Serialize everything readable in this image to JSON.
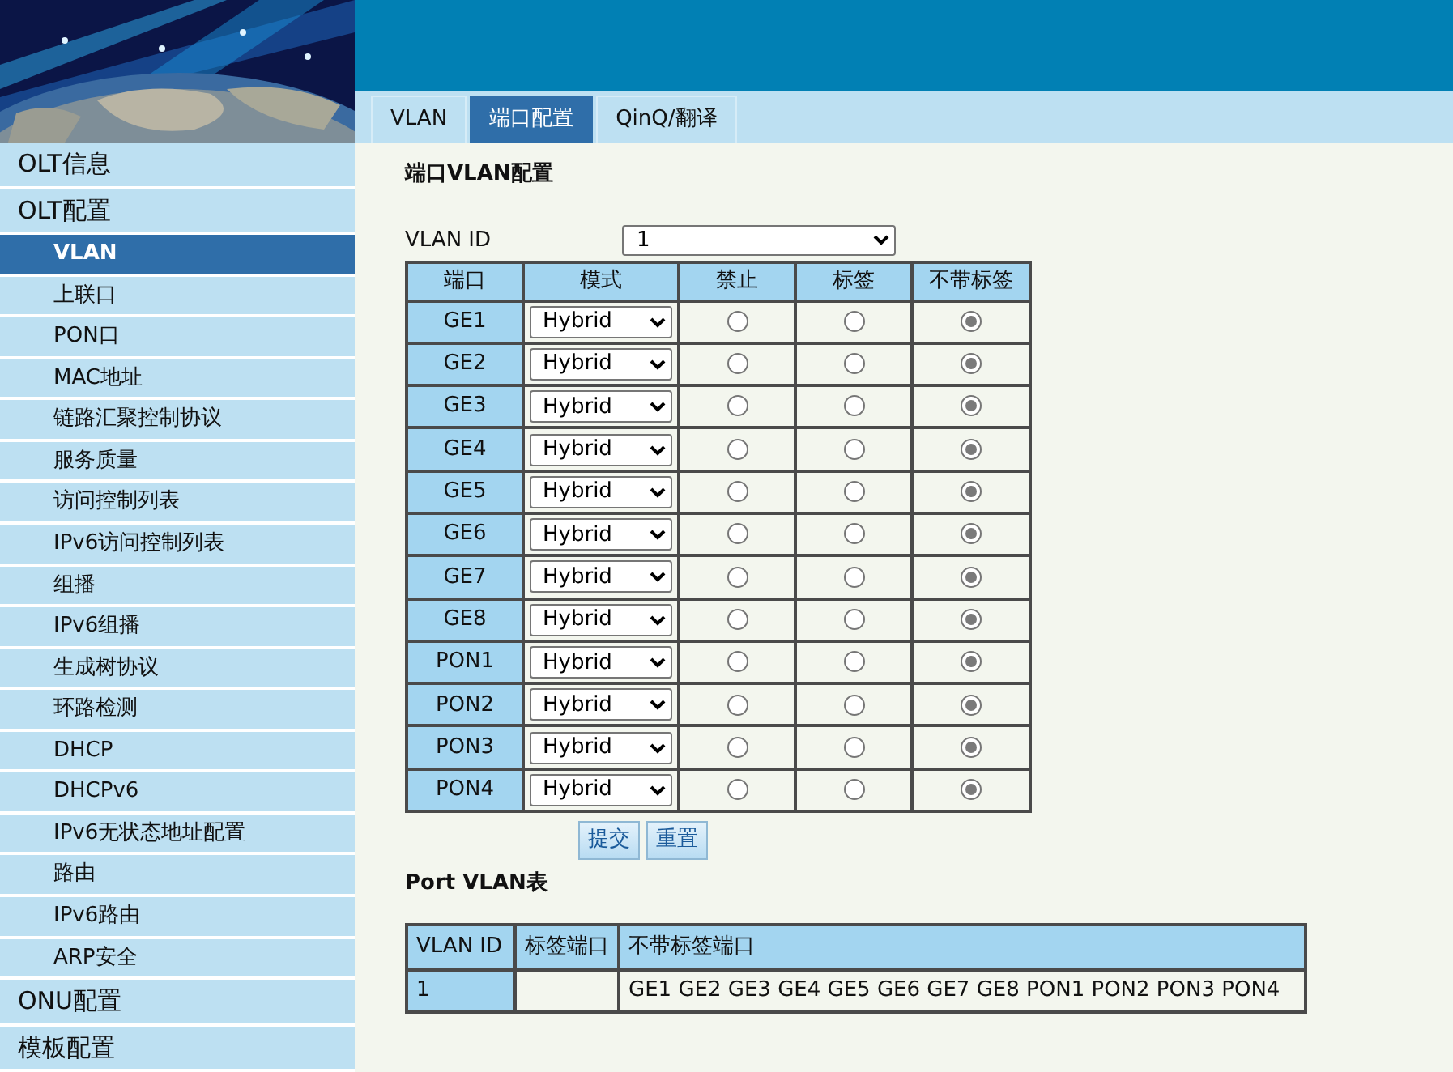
{
  "tabs": [
    {
      "label": "VLAN",
      "selected": false
    },
    {
      "label": "端口配置",
      "selected": true
    },
    {
      "label": "QinQ/翻译",
      "selected": false
    }
  ],
  "sidebar": {
    "items": [
      {
        "label": "OLT信息",
        "expanded": false
      },
      {
        "label": "OLT配置",
        "expanded": true,
        "children": [
          {
            "label": "VLAN",
            "selected": true
          },
          {
            "label": "上联口",
            "selected": false
          },
          {
            "label": "PON口",
            "selected": false
          },
          {
            "label": "MAC地址",
            "selected": false
          },
          {
            "label": "链路汇聚控制协议",
            "selected": false
          },
          {
            "label": "服务质量",
            "selected": false
          },
          {
            "label": "访问控制列表",
            "selected": false
          },
          {
            "label": "IPv6访问控制列表",
            "selected": false
          },
          {
            "label": "组播",
            "selected": false
          },
          {
            "label": "IPv6组播",
            "selected": false
          },
          {
            "label": "生成树协议",
            "selected": false
          },
          {
            "label": "环路检测",
            "selected": false
          },
          {
            "label": "DHCP",
            "selected": false
          },
          {
            "label": "DHCPv6",
            "selected": false
          },
          {
            "label": "IPv6无状态地址配置",
            "selected": false
          },
          {
            "label": "路由",
            "selected": false
          },
          {
            "label": "IPv6路由",
            "selected": false
          },
          {
            "label": "ARP安全",
            "selected": false
          }
        ]
      },
      {
        "label": "ONU配置",
        "expanded": false
      },
      {
        "label": "模板配置",
        "expanded": false
      }
    ]
  },
  "section_title": "端口VLAN配置",
  "vlan_id": {
    "label": "VLAN ID",
    "value": "1"
  },
  "port_table": {
    "columns": [
      "端口",
      "模式",
      "禁止",
      "标签",
      "不带标签"
    ],
    "rows": [
      {
        "port": "GE1",
        "mode": "Hybrid",
        "options": [
          {
            "selected": false
          },
          {
            "selected": false
          },
          {
            "selected": true
          }
        ]
      },
      {
        "port": "GE2",
        "mode": "Hybrid",
        "options": [
          {
            "selected": false
          },
          {
            "selected": false
          },
          {
            "selected": true
          }
        ]
      },
      {
        "port": "GE3",
        "mode": "Hybrid",
        "options": [
          {
            "selected": false
          },
          {
            "selected": false
          },
          {
            "selected": true
          }
        ]
      },
      {
        "port": "GE4",
        "mode": "Hybrid",
        "options": [
          {
            "selected": false
          },
          {
            "selected": false
          },
          {
            "selected": true
          }
        ]
      },
      {
        "port": "GE5",
        "mode": "Hybrid",
        "options": [
          {
            "selected": false
          },
          {
            "selected": false
          },
          {
            "selected": true
          }
        ]
      },
      {
        "port": "GE6",
        "mode": "Hybrid",
        "options": [
          {
            "selected": false
          },
          {
            "selected": false
          },
          {
            "selected": true
          }
        ]
      },
      {
        "port": "GE7",
        "mode": "Hybrid",
        "options": [
          {
            "selected": false
          },
          {
            "selected": false
          },
          {
            "selected": true
          }
        ]
      },
      {
        "port": "GE8",
        "mode": "Hybrid",
        "options": [
          {
            "selected": false
          },
          {
            "selected": false
          },
          {
            "selected": true
          }
        ]
      },
      {
        "port": "PON1",
        "mode": "Hybrid",
        "options": [
          {
            "selected": false
          },
          {
            "selected": false
          },
          {
            "selected": true
          }
        ]
      },
      {
        "port": "PON2",
        "mode": "Hybrid",
        "options": [
          {
            "selected": false
          },
          {
            "selected": false
          },
          {
            "selected": true
          }
        ]
      },
      {
        "port": "PON3",
        "mode": "Hybrid",
        "options": [
          {
            "selected": false
          },
          {
            "selected": false
          },
          {
            "selected": true
          }
        ]
      },
      {
        "port": "PON4",
        "mode": "Hybrid",
        "options": [
          {
            "selected": false
          },
          {
            "selected": false
          },
          {
            "selected": true
          }
        ]
      }
    ]
  },
  "buttons": [
    "提交",
    "重置"
  ],
  "vlan_table_title": "Port VLAN表",
  "vlan_table": {
    "columns": [
      "VLAN ID",
      "标签端口",
      "不带标签端口"
    ],
    "rows": [
      {
        "cells": [
          "1",
          "",
          "GE1 GE2 GE3 GE4 GE5 GE6 GE7 GE8 PON1 PON2 PON3 PON4"
        ]
      }
    ]
  }
}
